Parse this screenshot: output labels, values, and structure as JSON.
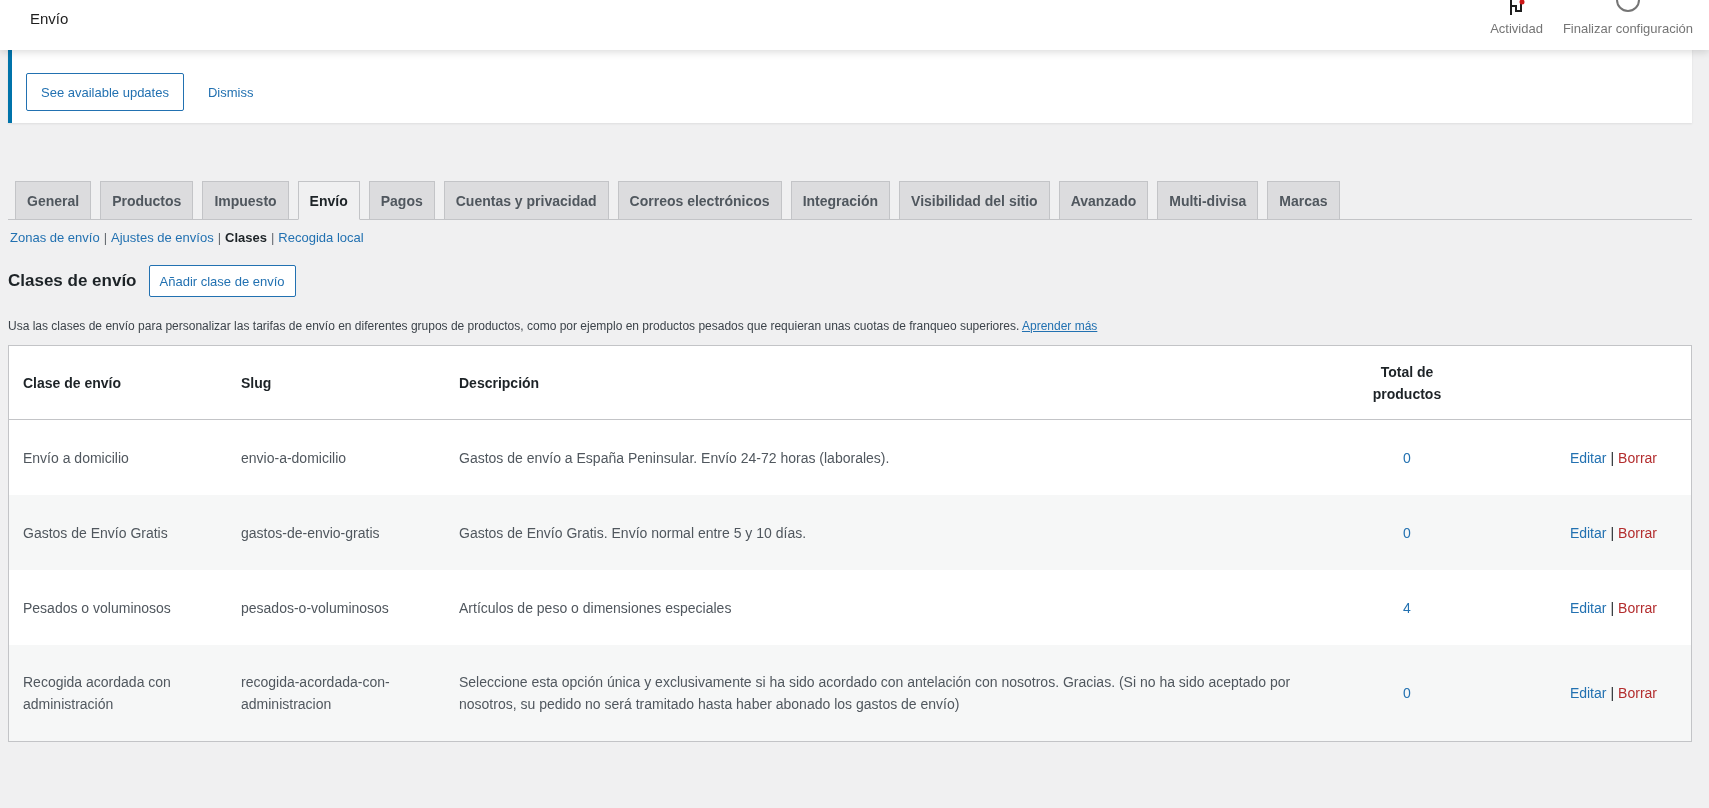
{
  "header": {
    "title": "Envío",
    "actions": [
      {
        "label": "Actividad",
        "kind": "flag"
      },
      {
        "label": "Finalizar configuración",
        "kind": "progress"
      }
    ]
  },
  "notice": {
    "buttons": [
      {
        "label": "See available updates",
        "kind": "outline"
      },
      {
        "label": "Dismiss",
        "kind": "link"
      }
    ]
  },
  "tabs": [
    {
      "label": "General",
      "selected": false
    },
    {
      "label": "Productos",
      "selected": false
    },
    {
      "label": "Impuesto",
      "selected": false
    },
    {
      "label": "Envío",
      "selected": true
    },
    {
      "label": "Pagos",
      "selected": false
    },
    {
      "label": "Cuentas y privacidad",
      "selected": false
    },
    {
      "label": "Correos electrónicos",
      "selected": false
    },
    {
      "label": "Integración",
      "selected": false
    },
    {
      "label": "Visibilidad del sitio",
      "selected": false
    },
    {
      "label": "Avanzado",
      "selected": false
    },
    {
      "label": "Multi-divisa",
      "selected": false
    },
    {
      "label": "Marcas",
      "selected": false
    }
  ],
  "subnav": {
    "separator": "|",
    "items": [
      {
        "label": "Zonas de envío",
        "selected": false
      },
      {
        "label": "Ajustes de envíos",
        "selected": false
      },
      {
        "label": "Clases",
        "selected": true
      },
      {
        "label": "Recogida local",
        "selected": false
      }
    ]
  },
  "section": {
    "title": "Clases de envío",
    "button": "Añadir clase de envío",
    "description": "Usa las clases de envío para personalizar las tarifas de envío en diferentes grupos de productos, como por ejemplo en productos pesados que requieran unas cuotas de franqueo superiores.",
    "link": "Aprender más"
  },
  "table": {
    "columns": [
      "Clase de envío",
      "Slug",
      "Descripción",
      "Total de productos"
    ],
    "action_separator": "|",
    "rows": [
      {
        "name": "Envío a domicilio",
        "slug": "envio-a-domicilio",
        "description": "Gastos de envío a España Peninsular. Envío 24-72 horas (laborales).",
        "total": "0",
        "actions": [
          {
            "label": "Editar",
            "kind": "edit"
          },
          {
            "label": "Borrar",
            "kind": "delete"
          }
        ]
      },
      {
        "name": "Gastos de Envío Gratis",
        "slug": "gastos-de-envio-gratis",
        "description": "Gastos de Envío Gratis. Envío normal entre 5 y 10 días.",
        "total": "0",
        "actions": [
          {
            "label": "Editar",
            "kind": "edit"
          },
          {
            "label": "Borrar",
            "kind": "delete"
          }
        ]
      },
      {
        "name": "Pesados o voluminosos",
        "slug": "pesados-o-voluminosos",
        "description": "Artículos de peso o dimensiones especiales",
        "total": "4",
        "actions": [
          {
            "label": "Editar",
            "kind": "edit"
          },
          {
            "label": "Borrar",
            "kind": "delete"
          }
        ]
      },
      {
        "name": "Recogida acordada con administración",
        "slug": "recogida-acordada-con-administracion",
        "description": "Seleccione esta opción única y exclusivamente si ha sido acordado con antelación con nosotros. Gracias. (Si no ha sido aceptado por nosotros, su pedido no será tramitado hasta haber abonado los gastos de envío)",
        "total": "0",
        "actions": [
          {
            "label": "Editar",
            "kind": "edit"
          },
          {
            "label": "Borrar",
            "kind": "delete"
          }
        ]
      }
    ]
  }
}
